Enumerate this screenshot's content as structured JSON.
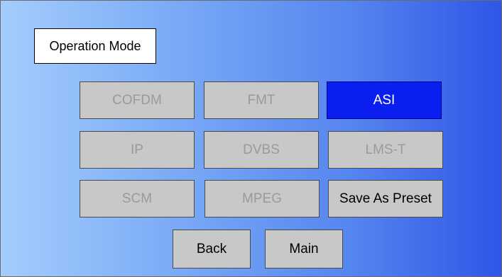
{
  "header": {
    "title": "Operation Mode"
  },
  "modes": {
    "cofdm": "COFDM",
    "fmt": "FMT",
    "asi": "ASI",
    "ip": "IP",
    "dvbs": "DVBS",
    "lmst": "LMS-T",
    "scm": "SCM",
    "mpeg": "MPEG"
  },
  "actions": {
    "save_preset": "Save As Preset",
    "back": "Back",
    "main": "Main"
  },
  "selected_mode": "ASI",
  "colors": {
    "selected": "#0a1ef0",
    "button_bg": "#c8c8c8",
    "disabled_text": "#9a9a9a",
    "gradient_start": "#a4cdfd",
    "gradient_end": "#2f55e6"
  }
}
